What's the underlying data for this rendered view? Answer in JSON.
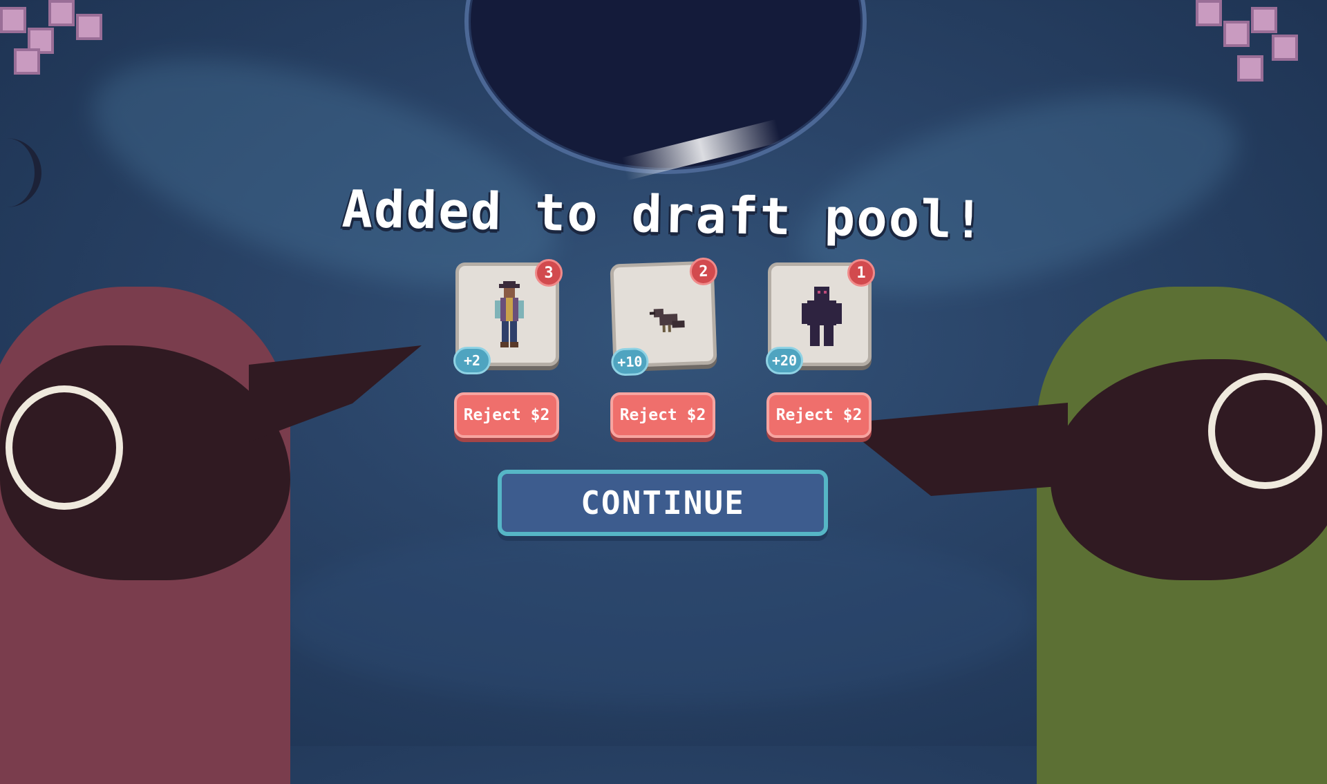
{
  "screen": {
    "title": "Added to draft pool!",
    "continue_label": "CONTINUE"
  },
  "cards": [
    {
      "name": "cowboy-card",
      "art_icon": "cowboy-figure-icon",
      "count": "3",
      "value": "+2",
      "reject_label": "Reject $2"
    },
    {
      "name": "crow-card",
      "art_icon": "crow-icon",
      "count": "2",
      "value": "+10",
      "reject_label": "Reject $2"
    },
    {
      "name": "shadow-card",
      "art_icon": "shadow-creature-icon",
      "count": "1",
      "value": "+20",
      "reject_label": "Reject $2"
    }
  ],
  "colors": {
    "background": "#2a4468",
    "reject_button": "#ef6f6c",
    "continue_button": "#3d5c8e",
    "continue_border": "#56b6c6",
    "count_badge": "#d24a4e",
    "value_badge": "#4fa4c0"
  }
}
